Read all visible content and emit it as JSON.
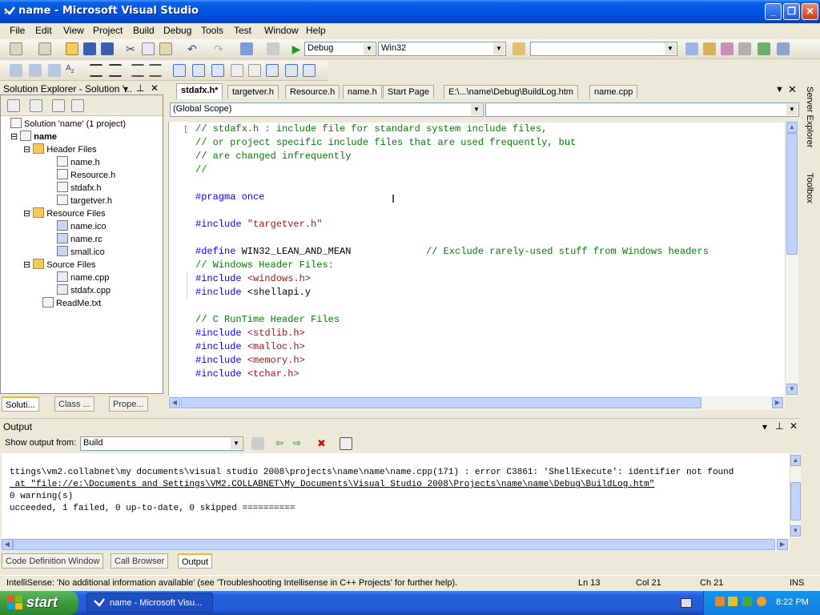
{
  "window": {
    "title": "name - Microsoft Visual Studio"
  },
  "menu": [
    "File",
    "Edit",
    "View",
    "Project",
    "Build",
    "Debug",
    "Tools",
    "Test",
    "Window",
    "Help"
  ],
  "toolbar": {
    "config": "Debug",
    "platform": "Win32",
    "find": ""
  },
  "solution_explorer": {
    "title": "Solution Explorer - Solution '...",
    "items": [
      {
        "label": "Solution 'name' (1 project)",
        "icon": "solution-icon"
      },
      {
        "label": "name",
        "icon": "project-icon"
      },
      {
        "label": "Header Files",
        "icon": "folder-icon"
      },
      {
        "label": "name.h",
        "icon": "header-file-icon"
      },
      {
        "label": "Resource.h",
        "icon": "header-file-icon"
      },
      {
        "label": "stdafx.h",
        "icon": "header-file-icon"
      },
      {
        "label": "targetver.h",
        "icon": "header-file-icon"
      },
      {
        "label": "Resource Files",
        "icon": "folder-icon"
      },
      {
        "label": "name.ico",
        "icon": "resource-file-icon"
      },
      {
        "label": "name.rc",
        "icon": "resource-file-icon"
      },
      {
        "label": "small.ico",
        "icon": "resource-file-icon"
      },
      {
        "label": "Source Files",
        "icon": "folder-icon"
      },
      {
        "label": "name.cpp",
        "icon": "cpp-file-icon"
      },
      {
        "label": "stdafx.cpp",
        "icon": "cpp-file-icon"
      },
      {
        "label": "ReadMe.txt",
        "icon": "text-file-icon"
      }
    ],
    "tabs": [
      "Soluti...",
      "Class ...",
      "Prope..."
    ]
  },
  "doc_tabs": [
    "stdafx.h*",
    "targetver.h",
    "Resource.h",
    "name.h",
    "Start Page",
    "E:\\...\\name\\Debug\\BuildLog.htm",
    "name.cpp"
  ],
  "scope": {
    "left": "(Global Scope)",
    "right": ""
  },
  "code": [
    {
      "parts": [
        {
          "t": "// stdafx.h : include file for standard system include files,",
          "c": "c"
        }
      ]
    },
    {
      "parts": [
        {
          "t": "// or project specific include files that are used frequently, but",
          "c": "c"
        }
      ]
    },
    {
      "parts": [
        {
          "t": "// are changed infrequently",
          "c": "c"
        }
      ]
    },
    {
      "parts": [
        {
          "t": "//",
          "c": "c"
        }
      ]
    },
    {
      "parts": []
    },
    {
      "parts": [
        {
          "t": "#pragma once",
          "c": "k"
        }
      ]
    },
    {
      "parts": []
    },
    {
      "parts": [
        {
          "t": "#include ",
          "c": "k"
        },
        {
          "t": "\"targetver.h\"",
          "c": "s"
        }
      ]
    },
    {
      "parts": []
    },
    {
      "parts": [
        {
          "t": "#define ",
          "c": "k"
        },
        {
          "t": "WIN32_LEAN_AND_MEAN             ",
          "c": "t"
        },
        {
          "t": "// Exclude rarely-used stuff from Windows headers",
          "c": "c"
        }
      ]
    },
    {
      "parts": [
        {
          "t": "// Windows Header Files:",
          "c": "c"
        }
      ]
    },
    {
      "parts": [
        {
          "t": "#include ",
          "c": "k"
        },
        {
          "t": "<windows.h>",
          "c": "s"
        }
      ]
    },
    {
      "parts": [
        {
          "t": "#include ",
          "c": "k"
        },
        {
          "t": "<shellapi.y",
          "c": "t"
        }
      ]
    },
    {
      "parts": []
    },
    {
      "parts": [
        {
          "t": "// C RunTime Header Files",
          "c": "c"
        }
      ]
    },
    {
      "parts": [
        {
          "t": "#include ",
          "c": "k"
        },
        {
          "t": "<stdlib.h>",
          "c": "s"
        }
      ]
    },
    {
      "parts": [
        {
          "t": "#include ",
          "c": "k"
        },
        {
          "t": "<malloc.h>",
          "c": "s"
        }
      ]
    },
    {
      "parts": [
        {
          "t": "#include ",
          "c": "k"
        },
        {
          "t": "<memory.h>",
          "c": "s"
        }
      ]
    },
    {
      "parts": [
        {
          "t": "#include ",
          "c": "k"
        },
        {
          "t": "<tchar.h>",
          "c": "s"
        }
      ]
    }
  ],
  "output": {
    "title": "Output",
    "show_from_label": "Show output from:",
    "source": "Build",
    "lines": [
      "ttings\\vm2.collabnet\\my documents\\visual studio 2008\\projects\\name\\name\\name.cpp(171) : error C3861: 'ShellExecute': identifier not found",
      " at \"file://e:\\Documents and Settings\\VM2.COLLABNET\\My Documents\\Visual Studio 2008\\Projects\\name\\name\\Debug\\BuildLog.htm\"",
      "0 warning(s)",
      "ucceeded, 1 failed, 0 up-to-date, 0 skipped =========="
    ],
    "tabs": [
      "Code Definition Window",
      "Call Browser",
      "Output"
    ]
  },
  "status": {
    "message": "IntelliSense: 'No additional information available'   (see 'Troubleshooting Intellisense in C++ Projects' for further help).",
    "ln": "Ln 13",
    "col": "Col 21",
    "ch": "Ch 21",
    "mode": "INS"
  },
  "right_sidebar": [
    "Server Explorer",
    "Toolbox"
  ],
  "taskbar": {
    "start": "start",
    "task": "name - Microsoft Visu...",
    "clock": "8:22 PM"
  }
}
